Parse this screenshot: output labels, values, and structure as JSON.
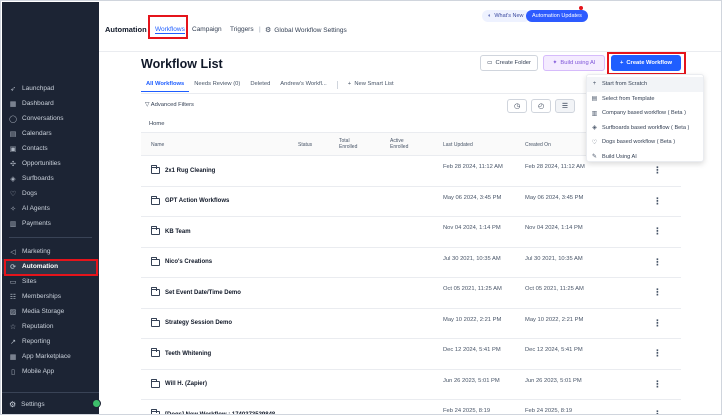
{
  "topbar": {
    "section_title": "Automation",
    "tabs": [
      "Workflows",
      "Campaign",
      "Triggers",
      "Global Workflow Settings"
    ],
    "whats_new": "What's New",
    "updates": "Automation Updates"
  },
  "sidebar": {
    "items": [
      {
        "label": "Launchpad",
        "icon": "rocket-icon"
      },
      {
        "label": "Dashboard",
        "icon": "dashboard-icon"
      },
      {
        "label": "Conversations",
        "icon": "chat-icon"
      },
      {
        "label": "Calendars",
        "icon": "calendar-icon"
      },
      {
        "label": "Contacts",
        "icon": "contacts-icon"
      },
      {
        "label": "Opportunities",
        "icon": "opportunities-icon"
      },
      {
        "label": "Surfboards",
        "icon": "surfboard-icon"
      },
      {
        "label": "Dogs",
        "icon": "dog-icon"
      },
      {
        "label": "AI Agents",
        "icon": "ai-icon"
      },
      {
        "label": "Payments",
        "icon": "payments-icon"
      }
    ],
    "items2": [
      {
        "label": "Marketing",
        "icon": "megaphone-icon"
      },
      {
        "label": "Automation",
        "icon": "automation-icon"
      },
      {
        "label": "Sites",
        "icon": "sites-icon"
      },
      {
        "label": "Memberships",
        "icon": "memberships-icon"
      },
      {
        "label": "Media Storage",
        "icon": "media-icon"
      },
      {
        "label": "Reputation",
        "icon": "star-icon"
      },
      {
        "label": "Reporting",
        "icon": "chart-icon"
      },
      {
        "label": "App Marketplace",
        "icon": "grid-icon"
      },
      {
        "label": "Mobile App",
        "icon": "mobile-icon"
      }
    ],
    "settings": "Settings"
  },
  "main": {
    "title": "Workflow List",
    "create_folder": "Create Folder",
    "build_ai": "Build using AI",
    "create_workflow": "Create Workflow",
    "tabs": [
      "All Workflows",
      "Needs Review (0)",
      "Deleted",
      "Andrew's Workfl..."
    ],
    "new_smart_list": "New Smart List",
    "advanced_filters": "Advanced Filters",
    "breadcrumb": "Home"
  },
  "table": {
    "headers": {
      "name": "Name",
      "status": "Status",
      "total_enrolled": "Total Enrolled",
      "active_enrolled": "Active Enrolled",
      "last_updated": "Last Updated",
      "created_on": "Created On"
    },
    "rows": [
      {
        "name": "2x1 Rug Cleaning",
        "updated": "Feb 28 2024, 11:12 AM",
        "created": "Feb 28 2024, 11:12 AM"
      },
      {
        "name": "GPT Action Workflows",
        "updated": "May 06 2024, 3:45 PM",
        "created": "May 06 2024, 3:45 PM"
      },
      {
        "name": "KB Team",
        "updated": "Nov 04 2024, 1:14 PM",
        "created": "Nov 04 2024, 1:14 PM"
      },
      {
        "name": "Nico's Creations",
        "updated": "Jul 30 2021, 10:35 AM",
        "created": "Jul 30 2021, 10:35 AM"
      },
      {
        "name": "Set Event Date/Time Demo",
        "updated": "Oct 05 2021, 11:25 AM",
        "created": "Oct 05 2021, 11:25 AM"
      },
      {
        "name": "Strategy Session Demo",
        "updated": "May 10 2022, 2:21 PM",
        "created": "May 10 2022, 2:21 PM"
      },
      {
        "name": "Teeth Whitening",
        "updated": "Dec 12 2024, 5:41 PM",
        "created": "Dec 12 2024, 5:41 PM"
      },
      {
        "name": "Will H. (Zapier)",
        "updated": "Jun 26 2023, 5:01 PM",
        "created": "Jun 26 2023, 5:01 PM"
      },
      {
        "name": "[Dogs] New Workflow : 1740373539848",
        "updated": "Feb 24 2025, 8:19",
        "created": "Feb 24 2025, 8:19"
      }
    ]
  },
  "dropdown": {
    "items": [
      {
        "label": "Start from Scratch",
        "icon": "plus-icon"
      },
      {
        "label": "Select from Template",
        "icon": "template-icon"
      },
      {
        "label": "Company based workflow ( Beta )",
        "icon": "company-icon"
      },
      {
        "label": "Surfboards based workflow ( Beta )",
        "icon": "surfboard-icon"
      },
      {
        "label": "Dogs based workflow ( Beta )",
        "icon": "dog-icon"
      },
      {
        "label": "Build Using AI",
        "icon": "wand-icon"
      }
    ]
  },
  "colors": {
    "accent": "#1f5eff",
    "sidebar": "#1c2434",
    "highlight": "#e5141b"
  }
}
